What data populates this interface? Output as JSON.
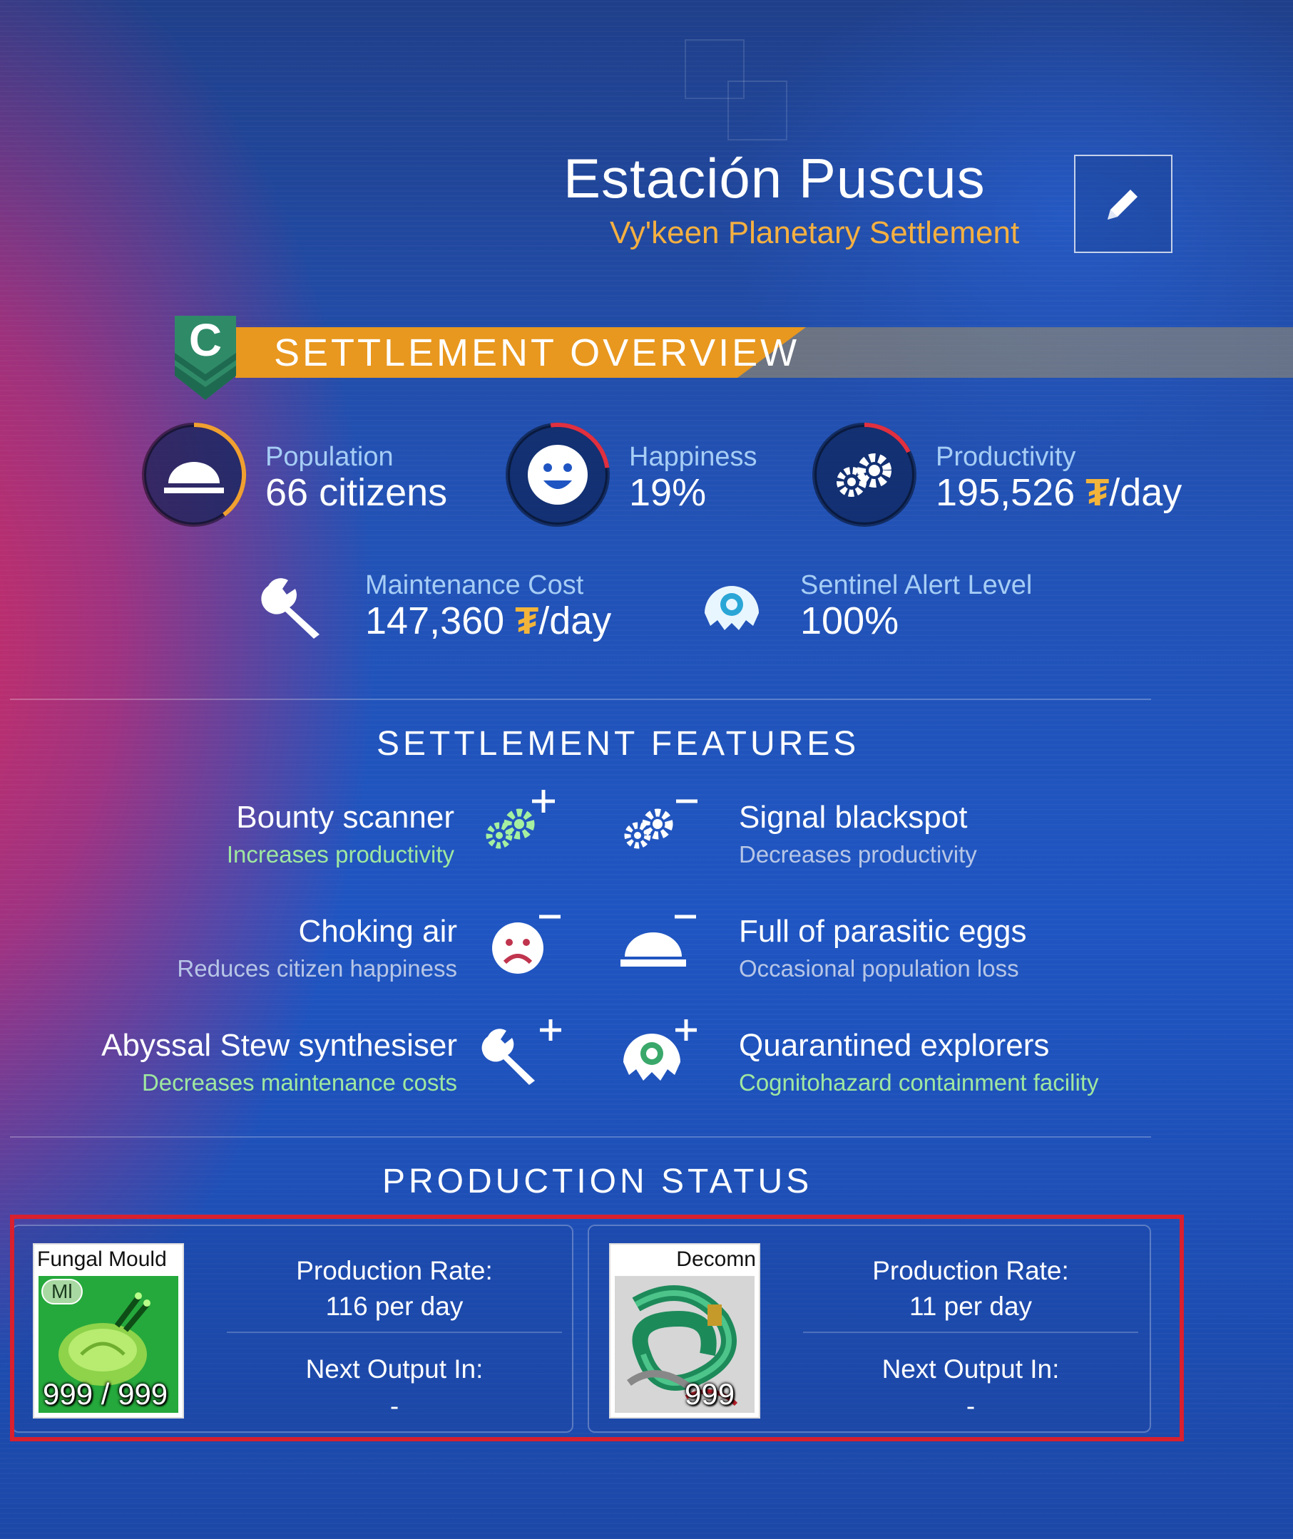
{
  "header": {
    "title": "Estación Puscus",
    "subtitle": "Vy'keen Planetary Settlement"
  },
  "overview": {
    "badge_letter": "C",
    "banner_title": "SETTLEMENT OVERVIEW",
    "stats": {
      "population": {
        "label": "Population",
        "value": "66 citizens",
        "icon": "dome-icon"
      },
      "happiness": {
        "label": "Happiness",
        "value": "19%",
        "icon": "smiley-icon"
      },
      "productivity": {
        "label": "Productivity",
        "value": "195,526",
        "unit": "/day",
        "icon": "gears-icon"
      },
      "maintenance": {
        "label": "Maintenance Cost",
        "value": "147,360",
        "unit": "/day",
        "icon": "wrench-icon"
      },
      "sentinel": {
        "label": "Sentinel Alert Level",
        "value": "100%",
        "icon": "sentinel-icon"
      }
    },
    "units_symbol": "₮"
  },
  "features": {
    "title": "SETTLEMENT FEATURES",
    "left": [
      {
        "name": "Bounty scanner",
        "desc": "Increases productivity",
        "icon": "gears-plus-icon"
      },
      {
        "name": "Choking air",
        "desc": "Reduces citizen happiness",
        "icon": "sad-face-minus-icon"
      },
      {
        "name": "Abyssal Stew synthesiser",
        "desc": "Decreases maintenance costs",
        "icon": "wrench-plus-icon"
      }
    ],
    "right": [
      {
        "name": "Signal blackspot",
        "desc": "Decreases productivity",
        "icon": "gears-minus-icon"
      },
      {
        "name": "Full of parasitic eggs",
        "desc": "Occasional population loss",
        "icon": "dome-minus-icon"
      },
      {
        "name": "Quarantined explorers",
        "desc": "Cognitohazard containment facility",
        "icon": "sentinel-plus-icon"
      }
    ],
    "plus": "+",
    "minus": "—"
  },
  "production": {
    "title": "PRODUCTION STATUS",
    "items": [
      {
        "name": "Fungal Mould",
        "tag": "Ml",
        "count": "999 / 999",
        "rate_label": "Production Rate:",
        "rate": "116 per day",
        "next_label": "Next Output In:",
        "next": "-"
      },
      {
        "name": "Decomn",
        "count": "999",
        "rate_label": "Production Rate:",
        "rate": "11 per day",
        "next_label": "Next Output In:",
        "next": "-"
      }
    ]
  },
  "colors": {
    "accent": "#e8981f",
    "subtitle": "#f4b041",
    "positive": "#9fe7a0",
    "negative": "#e04060",
    "highlight": "#d8202e"
  }
}
